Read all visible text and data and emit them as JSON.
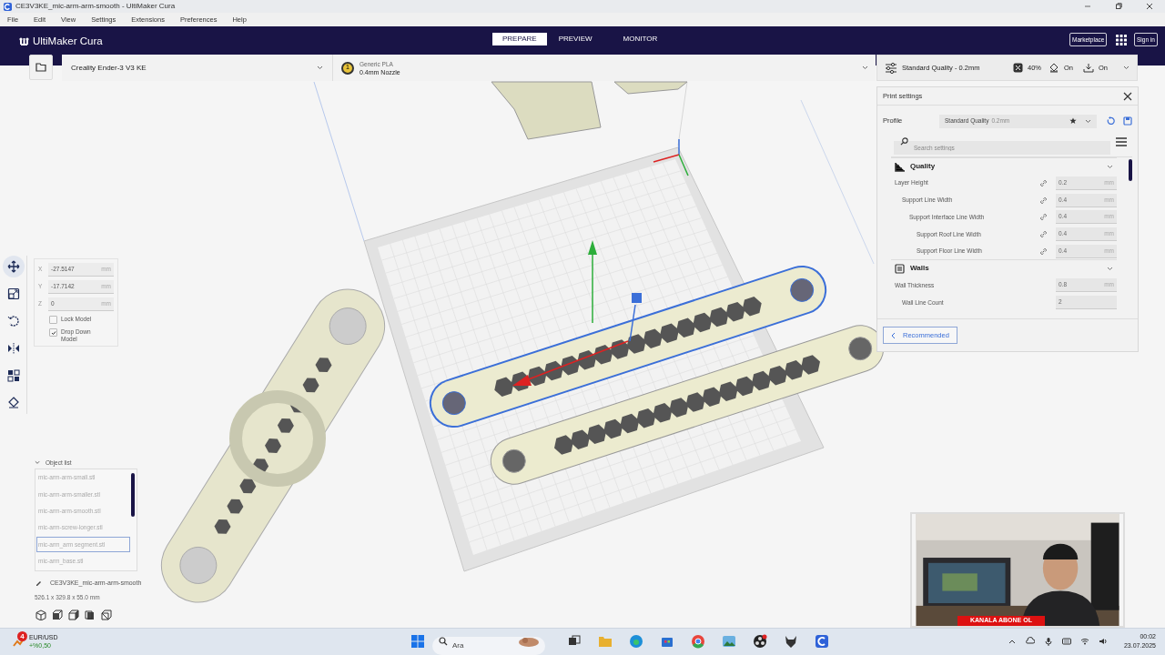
{
  "window": {
    "title": "CE3V3KE_mic-arm-arm-smooth - UltiMaker Cura"
  },
  "menu": [
    "File",
    "Edit",
    "View",
    "Settings",
    "Extensions",
    "Preferences",
    "Help"
  ],
  "header": {
    "logo": "UltiMaker Cura",
    "stages": [
      {
        "label": "PREPARE",
        "selected": true
      },
      {
        "label": "PREVIEW",
        "selected": false
      },
      {
        "label": "MONITOR",
        "selected": false
      }
    ],
    "marketplace": "Marketplace",
    "sign_in": "Sign in"
  },
  "printer_bar": {
    "printer": "Creality Ender-3 V3 KE",
    "extruder": "1",
    "material": "Generic PLA",
    "nozzle": "0.4mm Nozzle",
    "profile": "Standard Quality - 0.2mm",
    "infill": "40%",
    "support": "On",
    "adhesion": "On"
  },
  "tools": [
    {
      "kind": "move",
      "selected": true
    },
    {
      "kind": "scale",
      "selected": false
    },
    {
      "kind": "rotate",
      "selected": false
    },
    {
      "kind": "mirror",
      "selected": false
    },
    {
      "kind": "per-model",
      "selected": false
    },
    {
      "kind": "support-blocker",
      "selected": false
    }
  ],
  "move_panel": {
    "fields": [
      {
        "axis": "X",
        "value": "-27.5147",
        "unit": "mm"
      },
      {
        "axis": "Y",
        "value": "-17.7142",
        "unit": "mm"
      },
      {
        "axis": "Z",
        "value": "0",
        "unit": "mm"
      }
    ],
    "checkboxes": [
      {
        "label": "Lock Model",
        "checked": false
      },
      {
        "label": "Drop Down Model",
        "checked": true
      }
    ]
  },
  "object_list": {
    "title": "Object list",
    "expanded": true,
    "items": [
      {
        "label": "mic-arm-arm-small.stl",
        "selected": false
      },
      {
        "label": "mic-arm-arm-smaller.stl",
        "selected": false
      },
      {
        "label": "mic-arm-arm-smooth.stl",
        "selected": false
      },
      {
        "label": "mic-arm-screw-longer.stl",
        "selected": false
      },
      {
        "label": "mic-arm_arm segment.stl",
        "selected": true
      },
      {
        "label": "mic-arm_base.stl",
        "selected": false
      }
    ],
    "project_name": "CE3V3KE_mic-arm-arm-smooth",
    "dimensions": "526.1 x 329.8 x 55.0 mm"
  },
  "print_settings": {
    "title": "Print settings",
    "profile_label": "Profile",
    "profile_value": "Standard Quality",
    "profile_detail": "0.2mm",
    "search_placeholder": "Search settings",
    "sections": [
      {
        "kind": "quality",
        "title": "Quality",
        "expanded": true,
        "rows": [
          {
            "label": "Layer Height",
            "value": "0.2",
            "unit": "mm",
            "linked": true,
            "children": [
              {
                "label": "Support Line Width",
                "value": "0.4",
                "unit": "mm",
                "linked": true,
                "children": [
                  {
                    "label": "Support Interface Line Width",
                    "value": "0.4",
                    "unit": "mm",
                    "linked": true,
                    "children": [
                      {
                        "label": "Support Roof Line Width",
                        "value": "0.4",
                        "unit": "mm",
                        "linked": true
                      },
                      {
                        "label": "Support Floor Line Width",
                        "value": "0.4",
                        "unit": "mm",
                        "linked": true
                      }
                    ]
                  }
                ]
              }
            ]
          }
        ]
      },
      {
        "kind": "walls",
        "title": "Walls",
        "expanded": true,
        "rows": [
          {
            "label": "Wall Thickness",
            "value": "0.8",
            "unit": "mm",
            "linked": false,
            "children": [
              {
                "label": "Wall Line Count",
                "value": "2",
                "linked": false
              }
            ]
          }
        ]
      }
    ],
    "mode_button": "Recommended"
  },
  "webcam": {
    "kind": "picture",
    "banner": "KANALA ABONE OL"
  },
  "taskbar": {
    "widget_name": "EUR/USD",
    "widget_change": "+%0,50",
    "widget_badge": "4",
    "search_placeholder": "Ara",
    "time": "00:02",
    "date": "23.07.2025"
  }
}
